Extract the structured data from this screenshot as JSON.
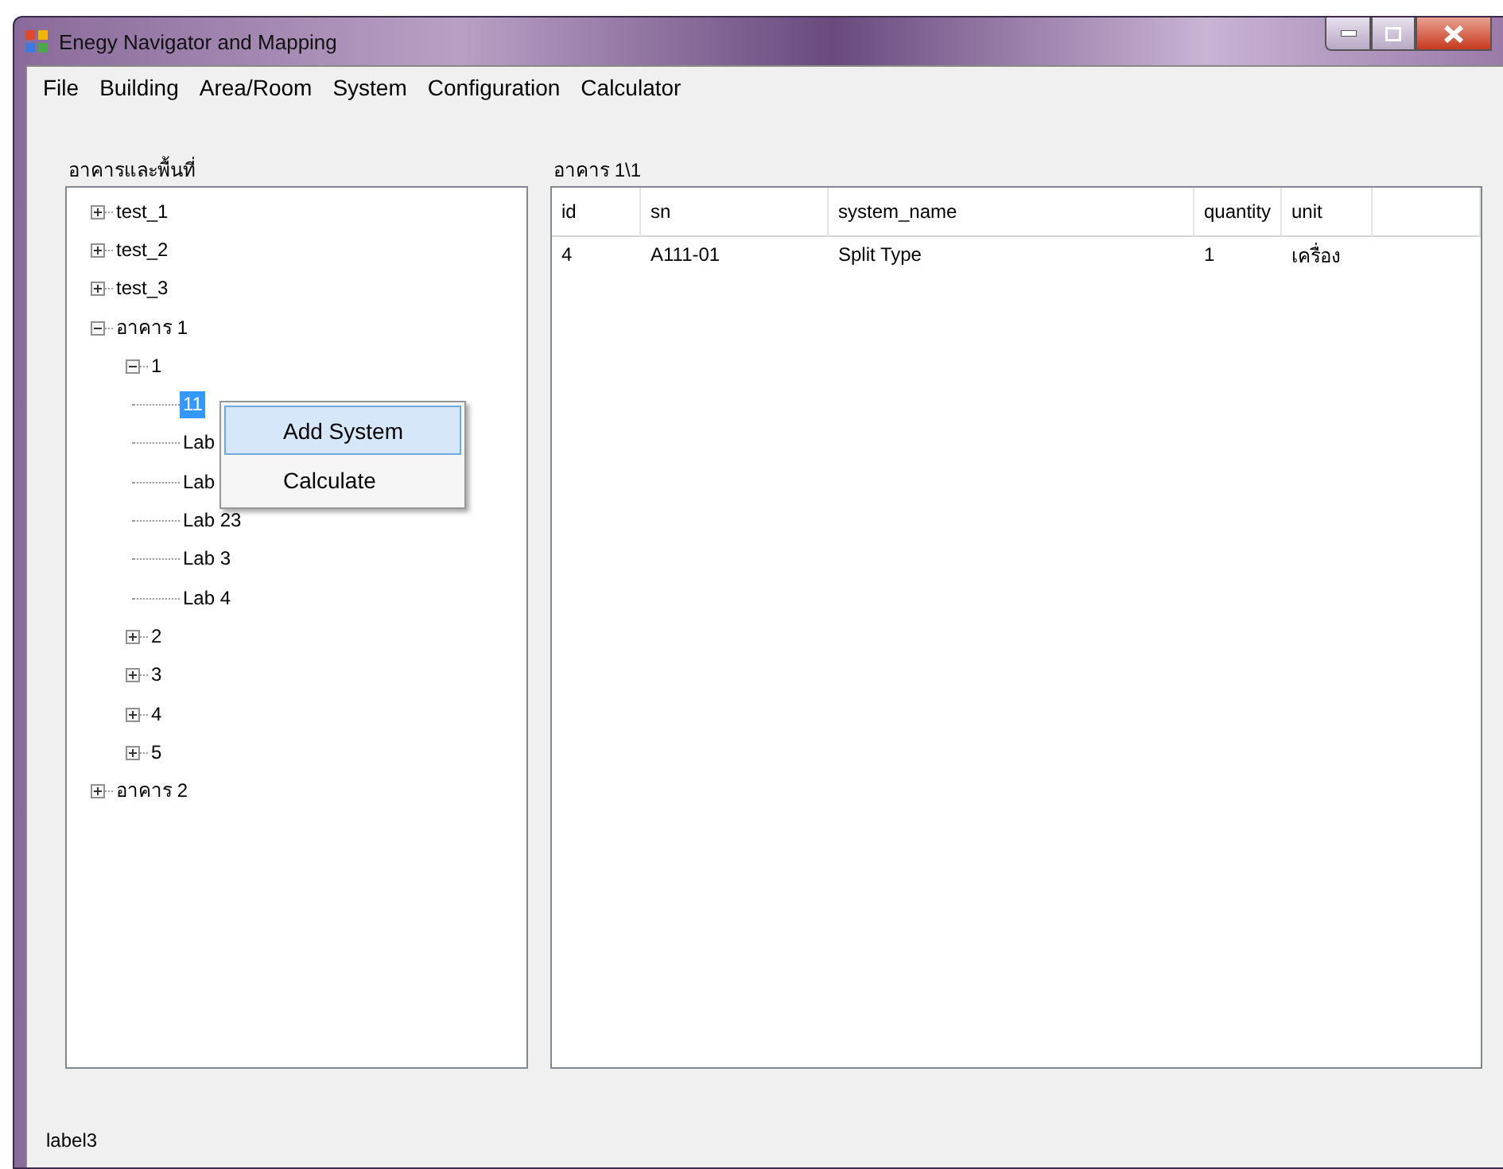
{
  "window": {
    "title": "Enegy Navigator and Mapping"
  },
  "menu_bar": [
    "File",
    "Building",
    "Area/Room",
    "System",
    "Configuration",
    "Calculator"
  ],
  "tree_panel": {
    "label": "อาคารและพื้นที่",
    "nodes": [
      {
        "label": "test_1",
        "expanded": false,
        "selected": false
      },
      {
        "label": "test_2",
        "expanded": false,
        "selected": false
      },
      {
        "label": "test_3",
        "expanded": false,
        "selected": false
      },
      {
        "label": "อาคาร 1",
        "expanded": true,
        "selected": false,
        "children": [
          {
            "label": "1",
            "expanded": true,
            "selected": false,
            "children": [
              {
                "label": "11",
                "selected": true
              },
              {
                "label": "Lab",
                "selected": false
              },
              {
                "label": "Lab",
                "selected": false
              },
              {
                "label": "Lab 23",
                "selected": false
              },
              {
                "label": "Lab 3",
                "selected": false
              },
              {
                "label": "Lab 4",
                "selected": false
              }
            ]
          },
          {
            "label": "2",
            "expanded": false,
            "selected": false
          },
          {
            "label": "3",
            "expanded": false,
            "selected": false
          },
          {
            "label": "4",
            "expanded": false,
            "selected": false
          },
          {
            "label": "5",
            "expanded": false,
            "selected": false
          }
        ]
      },
      {
        "label": "อาคาร 2",
        "expanded": false,
        "selected": false
      }
    ]
  },
  "context_menu": [
    {
      "label": "Add System",
      "highlighted": true
    },
    {
      "label": "Calculate",
      "highlighted": false
    }
  ],
  "grid_panel": {
    "label": "อาคาร 1\\1",
    "columns": [
      "id",
      "sn",
      "system_name",
      "quantity",
      "unit"
    ],
    "rows": [
      [
        "4",
        "A111-01",
        "Split Type",
        "1",
        "เครื่อง"
      ]
    ]
  },
  "status_label": "label3"
}
